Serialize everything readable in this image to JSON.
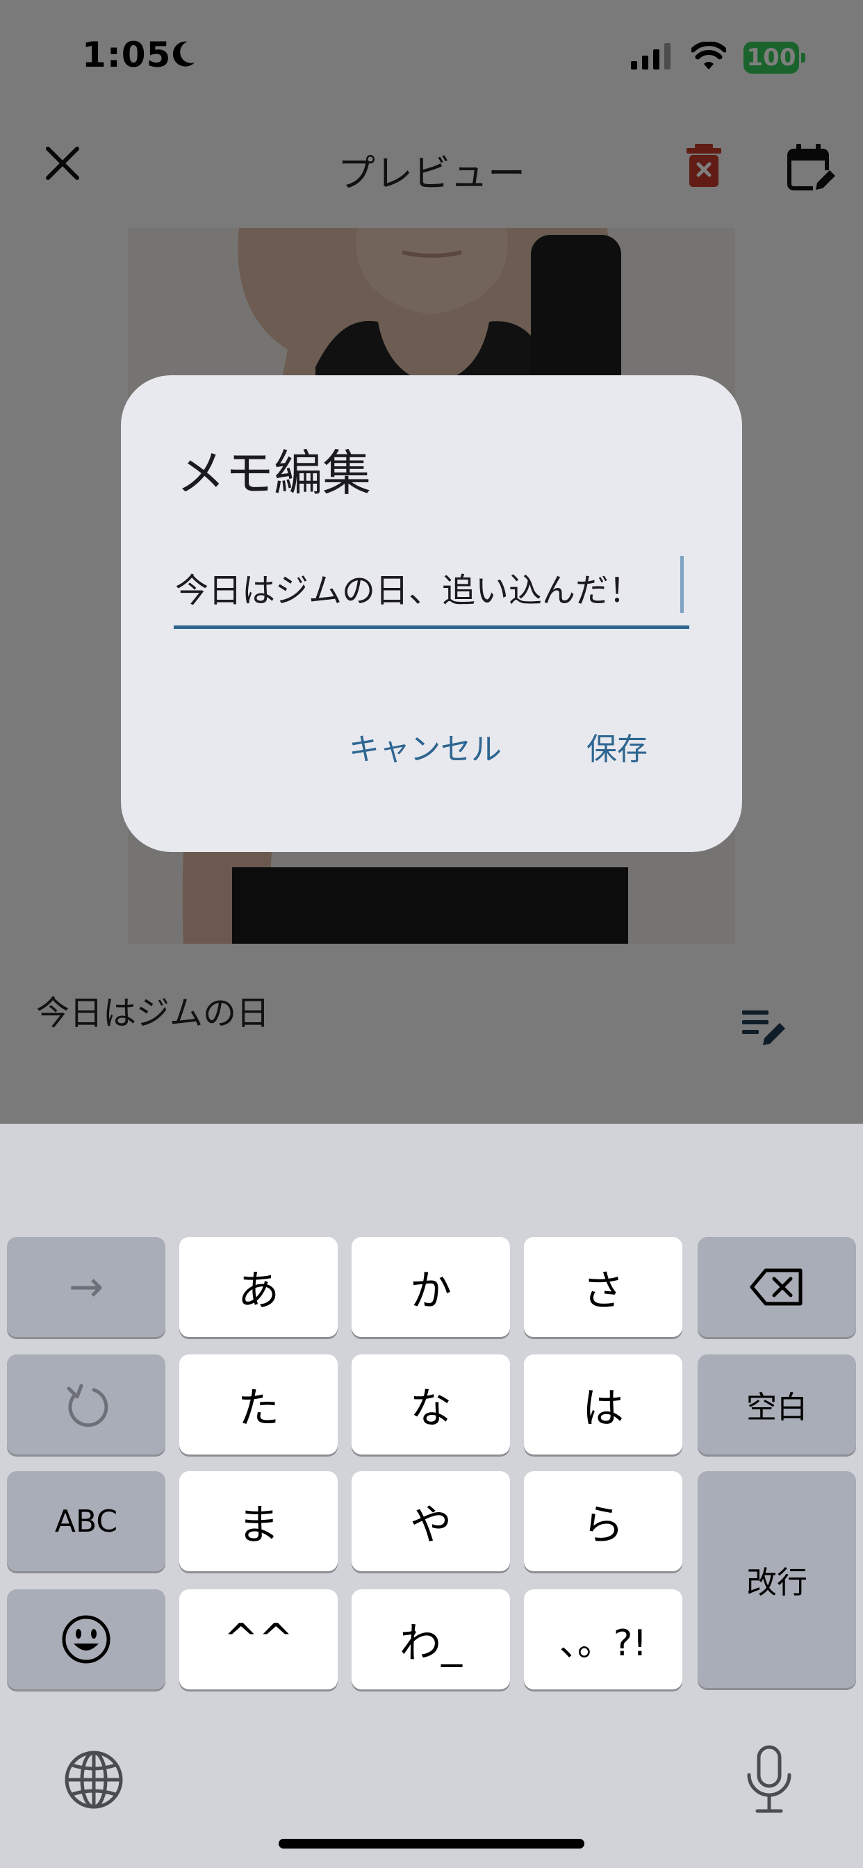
{
  "status_bar": {
    "time": "1:05",
    "battery": "100"
  },
  "appbar": {
    "title": "プレビュー"
  },
  "memo": {
    "text": "今日はジムの日"
  },
  "dialog": {
    "title": "メモ編集",
    "field_value": "今日はジムの日、追い込んだ！",
    "cancel_label": "キャンセル",
    "save_label": "保存"
  },
  "keyboard": {
    "keys": {
      "arrow": "→",
      "a": "あ",
      "ka": "か",
      "sa": "さ",
      "ta": "た",
      "na": "な",
      "ha": "は",
      "space": "空白",
      "abc": "ABC",
      "ma": "ま",
      "ya": "や",
      "ra": "ら",
      "enter": "改行",
      "kaomoji": "^^",
      "wa": "わ_",
      "punct": "、。?!"
    }
  },
  "colors": {
    "accent": "#2e6690",
    "battery": "#34c759",
    "delete": "#c0392b"
  }
}
